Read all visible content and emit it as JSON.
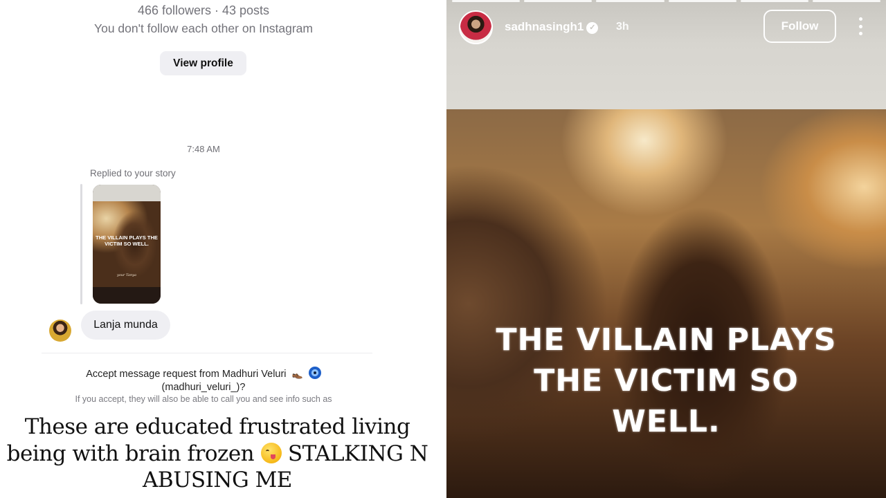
{
  "profile": {
    "stats": "466 followers · 43 posts",
    "relationship": "You don't follow each other on Instagram",
    "view_profile_label": "View profile"
  },
  "thread": {
    "timestamp": "7:48 AM",
    "replied_label": "Replied to your story",
    "story_thumb_text": "THE VILLAIN PLAYS THE VICTIM SO WELL.",
    "story_thumb_signature": "your Tanya",
    "message": "Lanja munda"
  },
  "request": {
    "accept_text": "Accept message request from Madhuri Veluri",
    "accept_handle": "(madhuri_veluri_)?",
    "info_text": "If you accept, they will also be able to call you and see info such as",
    "icons": [
      "shoe-icon",
      "nazar-eye-icon"
    ]
  },
  "caption": {
    "part1": "These are educated frustrated living being with brain frozen",
    "emoji": "face-savoring-food-emoji",
    "part2": "STALKING N ABUSING ME"
  },
  "story": {
    "username": "sadhnasingh1",
    "verified": true,
    "time_ago": "3h",
    "follow_label": "Follow",
    "text_line1": "THE VILLAIN PLAYS",
    "text_line2": "THE VICTIM SO",
    "text_line3": "WELL.",
    "progress_segments": 6
  },
  "colors": {
    "follow_border": "#ffffff",
    "bubble_bg": "#efeff3",
    "verified_badge": "#ffffff"
  }
}
